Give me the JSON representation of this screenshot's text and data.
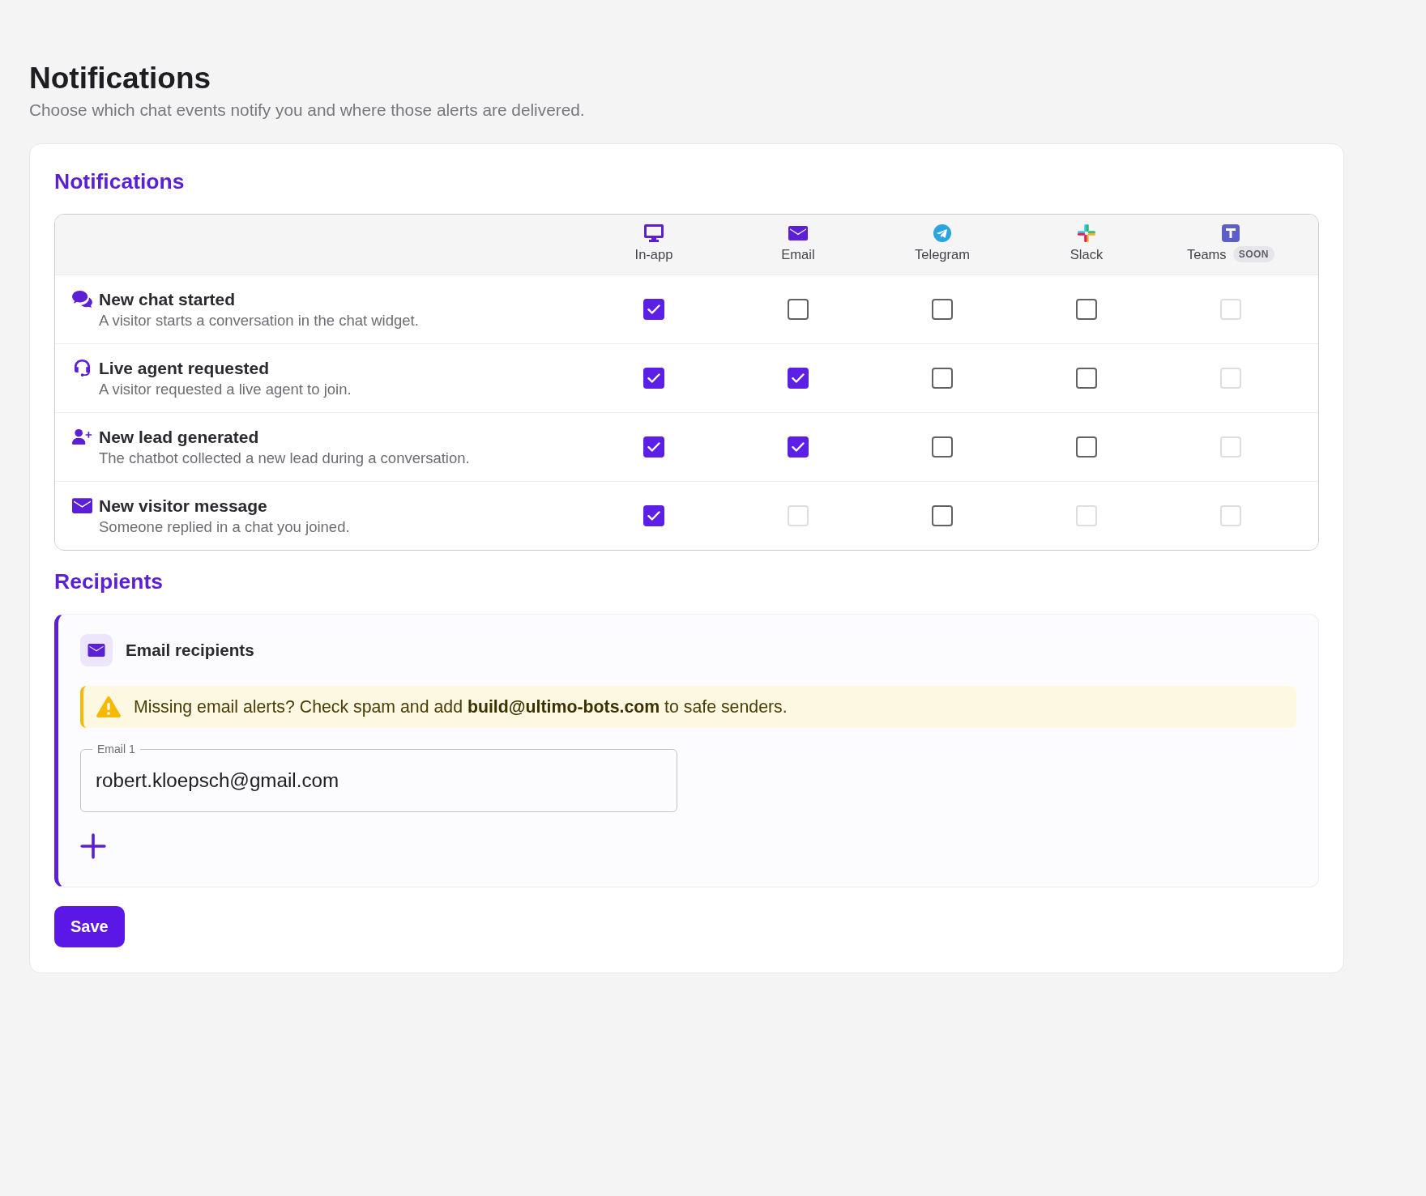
{
  "page": {
    "title": "Notifications",
    "subtitle": "Choose which chat events notify you and where those alerts are delivered."
  },
  "notifications": {
    "heading": "Notifications",
    "channels": [
      {
        "kind": "monitor",
        "label": "In-app"
      },
      {
        "kind": "envelope",
        "label": "Email"
      },
      {
        "kind": "telegram",
        "label": "Telegram"
      },
      {
        "kind": "slack",
        "label": "Slack"
      },
      {
        "kind": "teams",
        "label": "Teams",
        "badge": "SOON"
      }
    ],
    "events": [
      {
        "kind": "chat",
        "title": "New chat started",
        "description": "A visitor starts a conversation in the chat widget.",
        "checks": [
          {
            "checked": true,
            "disabled": false
          },
          {
            "checked": false,
            "disabled": false
          },
          {
            "checked": false,
            "disabled": false
          },
          {
            "checked": false,
            "disabled": false
          },
          {
            "checked": false,
            "disabled": true
          }
        ]
      },
      {
        "kind": "headset",
        "title": "Live agent requested",
        "description": "A visitor requested a live agent to join.",
        "checks": [
          {
            "checked": true,
            "disabled": false
          },
          {
            "checked": true,
            "disabled": false
          },
          {
            "checked": false,
            "disabled": false
          },
          {
            "checked": false,
            "disabled": false
          },
          {
            "checked": false,
            "disabled": true
          }
        ]
      },
      {
        "kind": "user-plus",
        "title": "New lead generated",
        "description": "The chatbot collected a new lead during a conversation.",
        "checks": [
          {
            "checked": true,
            "disabled": false
          },
          {
            "checked": true,
            "disabled": false
          },
          {
            "checked": false,
            "disabled": false
          },
          {
            "checked": false,
            "disabled": false
          },
          {
            "checked": false,
            "disabled": true
          }
        ]
      },
      {
        "kind": "envelope",
        "title": "New visitor message",
        "description": "Someone replied in a chat you joined.",
        "checks": [
          {
            "checked": true,
            "disabled": false
          },
          {
            "checked": false,
            "disabled": true
          },
          {
            "checked": false,
            "disabled": false
          },
          {
            "checked": false,
            "disabled": true
          },
          {
            "checked": false,
            "disabled": true
          }
        ]
      }
    ]
  },
  "recipients": {
    "heading": "Recipients",
    "email": {
      "title": "Email recipients",
      "notice": "Missing email alerts? Check spam and add **build@ultimo-bots.com** to safe senders.",
      "fields": [
        {
          "label": "Email 1",
          "value": "robert.kloepsch@gmail.com"
        }
      ]
    }
  },
  "save_button": "Save"
}
